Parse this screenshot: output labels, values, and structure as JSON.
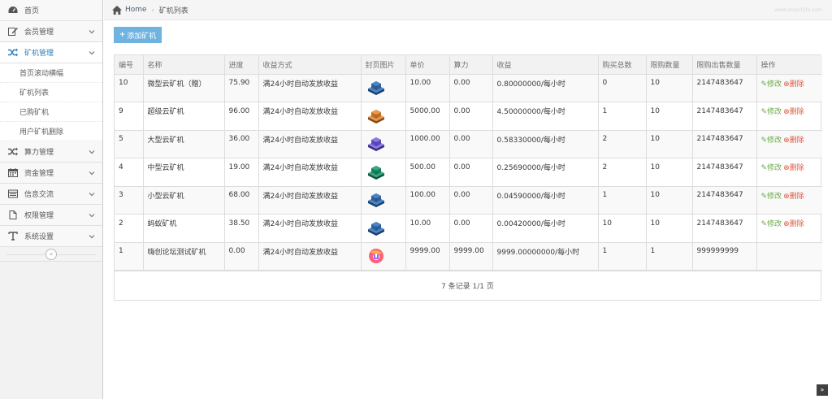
{
  "sidebar": {
    "items": [
      {
        "label": "首页",
        "icon": "dashboard-icon",
        "has_chevron": false
      },
      {
        "label": "会员管理",
        "icon": "edit-icon",
        "has_chevron": true
      },
      {
        "label": "矿机管理",
        "icon": "shuffle-icon",
        "has_chevron": true,
        "active": true,
        "children": [
          "首页滚动横幅",
          "矿机列表",
          "已购矿机",
          "用户矿机删除"
        ]
      },
      {
        "label": "算力管理",
        "icon": "shuffle-icon",
        "has_chevron": true
      },
      {
        "label": "资金管理",
        "icon": "calendar-icon",
        "has_chevron": true
      },
      {
        "label": "信息交流",
        "icon": "list-icon",
        "has_chevron": true
      },
      {
        "label": "权限管理",
        "icon": "file-icon",
        "has_chevron": true
      },
      {
        "label": "系统设置",
        "icon": "text-icon",
        "has_chevron": true
      }
    ],
    "collapse_glyph": "«"
  },
  "breadcrumb": {
    "home": "Home",
    "current": "矿机列表",
    "watermark": "www.anwufufa.com"
  },
  "toolbar": {
    "add_label": "添加矿机",
    "add_plus": "+"
  },
  "colors": {
    "accent": "#2b7dbc",
    "button": "#6fb3e0",
    "edit": "#69aa46",
    "delete": "#dd5a43"
  },
  "table": {
    "headers": [
      "编号",
      "名称",
      "进度",
      "收益方式",
      "封页图片",
      "单价",
      "算力",
      "收益",
      "购买总数",
      "限购数量",
      "限购出售数量",
      "操作"
    ],
    "rows": [
      {
        "id": "10",
        "name": "微型云矿机（赠）",
        "progress": "75.90",
        "method": "满24小时自动发放收益",
        "image": "blue-cube-icon",
        "price": "10.00",
        "power": "0.00",
        "income": "0.80000000/每小时",
        "total": "0",
        "limit": "10",
        "sell_limit": "2147483647",
        "edit": "修改",
        "del": "删除"
      },
      {
        "id": "9",
        "name": "超级云矿机",
        "progress": "96.00",
        "method": "满24小时自动发放收益",
        "image": "orange-cube-icon",
        "price": "5000.00",
        "power": "0.00",
        "income": "4.50000000/每小时",
        "total": "1",
        "limit": "10",
        "sell_limit": "2147483647",
        "edit": "修改",
        "del": "删除"
      },
      {
        "id": "5",
        "name": "大型云矿机",
        "progress": "36.00",
        "method": "满24小时自动发放收益",
        "image": "purple-cube-icon",
        "price": "1000.00",
        "power": "0.00",
        "income": "0.58330000/每小时",
        "total": "2",
        "limit": "10",
        "sell_limit": "2147483647",
        "edit": "修改",
        "del": "删除"
      },
      {
        "id": "4",
        "name": "中型云矿机",
        "progress": "19.00",
        "method": "满24小时自动发放收益",
        "image": "green-cube-icon",
        "price": "500.00",
        "power": "0.00",
        "income": "0.25690000/每小时",
        "total": "2",
        "limit": "10",
        "sell_limit": "2147483647",
        "edit": "修改",
        "del": "删除"
      },
      {
        "id": "3",
        "name": "小型云矿机",
        "progress": "68.00",
        "method": "满24小时自动发放收益",
        "image": "blue-cube-icon",
        "price": "100.00",
        "power": "0.00",
        "income": "0.04590000/每小时",
        "total": "1",
        "limit": "10",
        "sell_limit": "2147483647",
        "edit": "修改",
        "del": "删除"
      },
      {
        "id": "2",
        "name": "蚂蚁矿机",
        "progress": "38.50",
        "method": "满24小时自动发放收益",
        "image": "blue-cube-icon",
        "price": "10.00",
        "power": "0.00",
        "income": "0.00420000/每小时",
        "total": "10",
        "limit": "10",
        "sell_limit": "2147483647",
        "edit": "修改",
        "del": "删除"
      },
      {
        "id": "1",
        "name": "嗨创论坛测试矿机",
        "progress": "0.00",
        "method": "满24小时自动发放收益",
        "image": "logo-badge-icon",
        "price": "9999.00",
        "power": "9999.00",
        "income": "9999.00000000/每小时",
        "total": "1",
        "limit": "1",
        "sell_limit": "999999999",
        "edit": "",
        "del": ""
      }
    ],
    "footer": "7 条记录 1/1 页"
  },
  "scroll_top_glyph": "»"
}
